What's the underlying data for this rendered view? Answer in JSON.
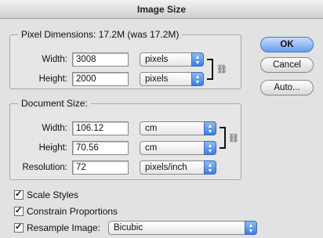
{
  "window": {
    "title": "Image Size"
  },
  "pixel_dimensions": {
    "title": "Pixel Dimensions:",
    "summary": "17.2M (was 17.2M)",
    "width": {
      "label": "Width:",
      "value": "3008",
      "unit": "pixels"
    },
    "height": {
      "label": "Height:",
      "value": "2000",
      "unit": "pixels"
    }
  },
  "document_size": {
    "title": "Document Size:",
    "width": {
      "label": "Width:",
      "value": "106.12",
      "unit": "cm"
    },
    "height": {
      "label": "Height:",
      "value": "70.56",
      "unit": "cm"
    },
    "resolution": {
      "label": "Resolution:",
      "value": "72",
      "unit": "pixels/inch"
    }
  },
  "buttons": {
    "ok": "OK",
    "cancel": "Cancel",
    "auto": "Auto..."
  },
  "options": {
    "scale_styles": {
      "label": "Scale Styles",
      "checked": true
    },
    "constrain_proportions": {
      "label": "Constrain Proportions",
      "checked": true
    },
    "resample": {
      "label": "Resample Image:",
      "checked": true,
      "method": "Bicubic"
    }
  },
  "icons": {
    "link": "chain-link-icon",
    "check": "checkmark-icon",
    "dropdown": "updown-arrow-icon"
  }
}
